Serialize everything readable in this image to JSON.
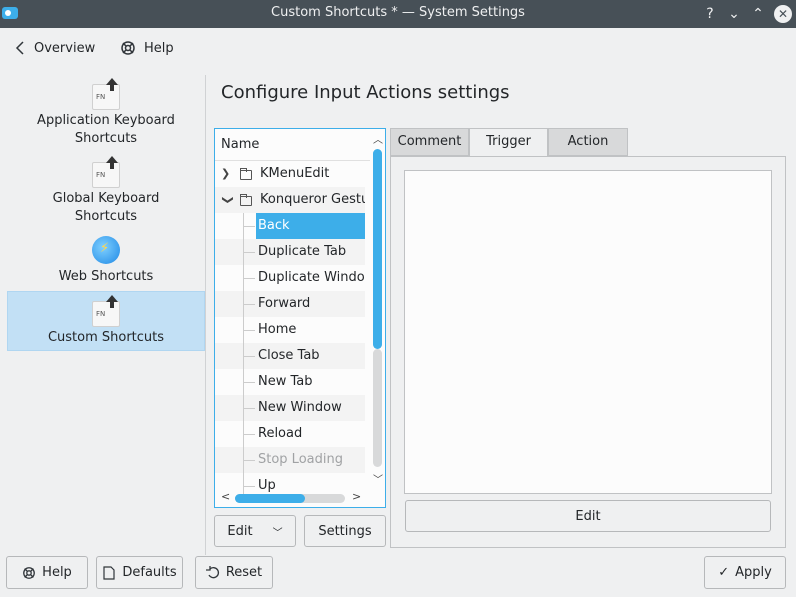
{
  "window": {
    "title": "Custom Shortcuts * — System Settings"
  },
  "titlebar_buttons": {
    "help": "?",
    "minimize": "⌄",
    "maximize": "⌃",
    "close": "✕"
  },
  "toolbar": {
    "overview": "Overview",
    "help": "Help"
  },
  "sidebar": {
    "items": [
      {
        "label": "Application Keyboard\nShortcuts",
        "line1": "Application Keyboard",
        "line2": "Shortcuts"
      },
      {
        "label": "Global Keyboard Shortcuts",
        "line1": "Global Keyboard",
        "line2": "Shortcuts"
      },
      {
        "label": "Web Shortcuts"
      },
      {
        "label": "Custom Shortcuts"
      }
    ],
    "selected": "Custom Shortcuts"
  },
  "page": {
    "title": "Configure Input Actions settings"
  },
  "tree": {
    "header": "Name",
    "groups": [
      {
        "label": "KMenuEdit",
        "expanded": false
      },
      {
        "label": "Konqueror Gestures",
        "expanded": true
      }
    ],
    "leaves": [
      {
        "label": "Back",
        "selected": true
      },
      {
        "label": "Duplicate Tab"
      },
      {
        "label": "Duplicate Window"
      },
      {
        "label": "Forward"
      },
      {
        "label": "Home"
      },
      {
        "label": "Close Tab"
      },
      {
        "label": "New Tab"
      },
      {
        "label": "New Window"
      },
      {
        "label": "Reload"
      },
      {
        "label": "Stop Loading",
        "disabled": true
      },
      {
        "label": "Up"
      }
    ]
  },
  "tree_buttons": {
    "edit": "Edit",
    "settings": "Settings"
  },
  "tabs": {
    "comment": "Comment",
    "trigger": "Trigger",
    "action": "Action",
    "active": "Trigger"
  },
  "trigger": {
    "edit": "Edit",
    "gesture_colors": [
      "#0000c8",
      "#1e90a0",
      "#32e632"
    ]
  },
  "footer": {
    "help": "Help",
    "defaults": "Defaults",
    "reset": "Reset",
    "apply": "Apply"
  },
  "colors": {
    "accent": "#3daee9",
    "titlebar": "#475057"
  }
}
